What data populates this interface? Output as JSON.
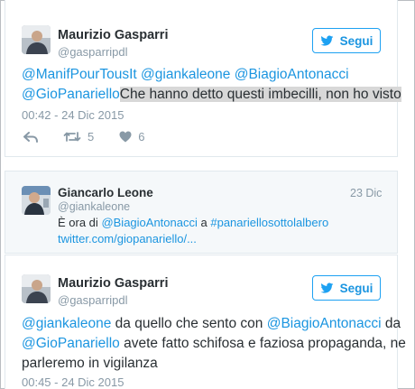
{
  "tweet1": {
    "name": "Maurizio Gasparri",
    "handle": "@gasparripdl",
    "follow_label": "Segui",
    "line1": {
      "m1": "@ManifPourTousIt",
      "m2": "@giankaleone",
      "m3": "@BiagioAntonacci"
    },
    "line2": {
      "m4": "@GioPanariello",
      "text": "Che hanno detto questi imbecilli, non ho visto"
    },
    "time": "00:42 - 24 Dic 2015",
    "retweets": "5",
    "likes": "6"
  },
  "tweet2": {
    "name": "Giancarlo Leone",
    "handle": "@giankaleone",
    "date": "23 Dic",
    "line1": {
      "t1": "È ora di",
      "m1": "@BiagioAntonacci",
      "t2": "a",
      "h1": "#panariellosottolalbero"
    },
    "link": "twitter.com/giopanariello/..."
  },
  "tweet3": {
    "name": "Maurizio Gasparri",
    "handle": "@gasparripdl",
    "follow_label": "Segui",
    "line1": {
      "m1": "@giankaleone",
      "t1": "da quello che sento con",
      "m2": "@BiagioAntonacci",
      "t2": "da"
    },
    "line2": {
      "m3": "@GioPanariello",
      "t1": "avete fatto schifosa e faziosa propaganda, ne"
    },
    "line3": "parleremo in vigilanza",
    "time": "00:45 - 24 Dic 2015"
  },
  "colors": {
    "link": "#1b95e0",
    "muted": "#8899a6",
    "text": "#292f33"
  }
}
